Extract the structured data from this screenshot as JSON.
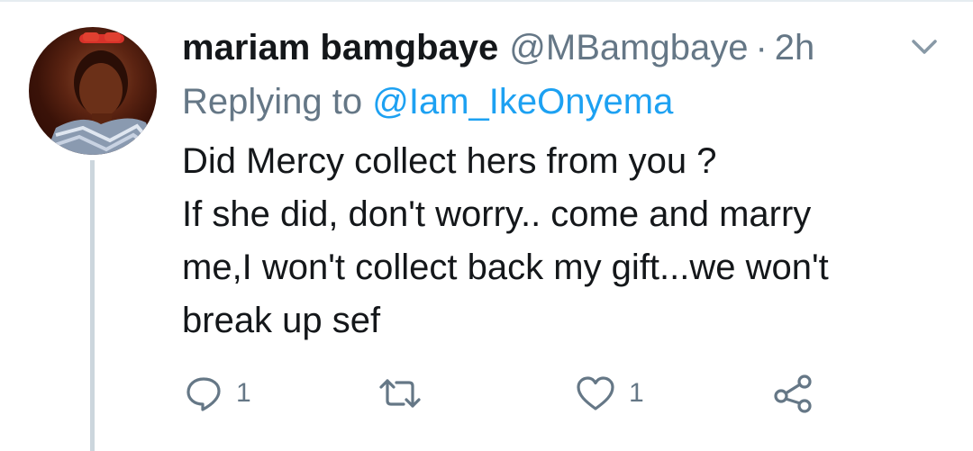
{
  "tweet": {
    "author_name": "mariam bamgbaye",
    "author_handle": "@MBamgbaye",
    "separator": "·",
    "time": "2h",
    "replying_prefix": "Replying to",
    "replying_to": "@Iam_IkeOnyema",
    "text_lines": [
      "Did Mercy collect hers from you ?",
      "If she did, don't worry.. come and marry",
      "me,I won't collect back my gift...we won't",
      "break up sef"
    ]
  },
  "actions": {
    "reply": {
      "icon": "reply-icon",
      "count": "1"
    },
    "retweet": {
      "icon": "retweet-icon",
      "count": ""
    },
    "like": {
      "icon": "like-icon",
      "count": "1"
    },
    "share": {
      "icon": "share-icon"
    }
  },
  "colors": {
    "text": "#14171a",
    "muted": "#657786",
    "link": "#1da1f2",
    "thread_line": "#ccd6dd"
  }
}
